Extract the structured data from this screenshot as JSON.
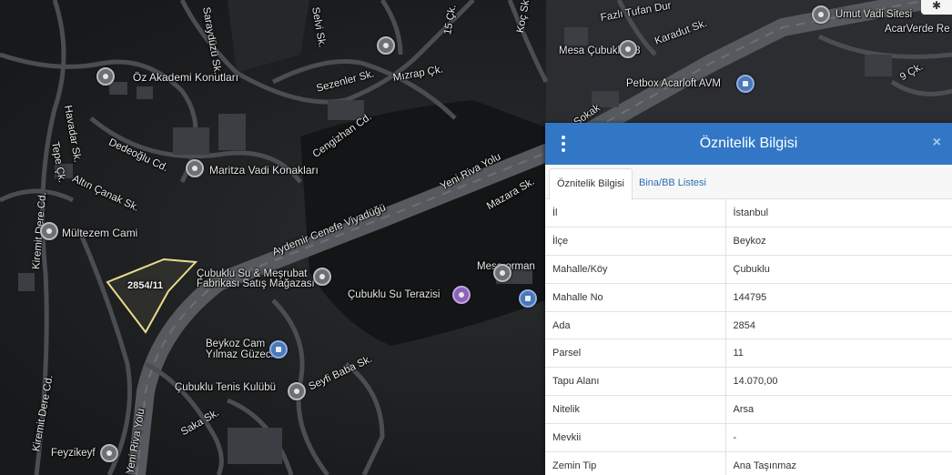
{
  "map": {
    "labels": [
      "Öz Akademi Konutları",
      "Maritza Vadi Konakları",
      "Mültezem Cami",
      "Çubuklu Su & Meşrubat",
      "Fabrikası Satış Mağazası",
      "Çubuklu Su Terazisi",
      "Beykoz Cam",
      "Yılmaz Güzeci",
      "Çubuklu Tenis Kulübü",
      "Feyzikeyf",
      "Mesa orman",
      "Mesa Çubuklu 28",
      "Petbox Acarloft AVM",
      "Umut Vadi Sitesi",
      "AcarVerde Re",
      "Yeni Riva Yolu",
      "Aydemir Cenefe Viyadüğü",
      "Dedeoğlu Cd.",
      "Altın Çanak Sk.",
      "Havadar Sk.",
      "Tepe Çk.",
      "Kiremit Dere Cd.",
      "Sezenler Sk.",
      "Mızrap Çk.",
      "Cengizhan Cd.",
      "Karadut Sk.",
      "Seyfi Baba Sk.",
      "Saka Sk.",
      "Yeni Riva Yolu",
      "Sokak",
      "Mazara Sk.",
      "Kiremit Dere Cd.",
      "Fazlı Tufan Dur",
      "Selvi Sk.",
      "Koç Sk.",
      "15 Çk.",
      "9 Çk.",
      "Saraydüzü Sk."
    ],
    "parcel_label": "2854/11"
  },
  "panel": {
    "title": "Öznitelik Bilgisi",
    "close": "×",
    "tabs": [
      "Öznitelik Bilgisi",
      "Bina/BB Listesi"
    ],
    "rows": [
      {
        "k": "İl",
        "v": "İstanbul"
      },
      {
        "k": "İlçe",
        "v": "Beykoz"
      },
      {
        "k": "Mahalle/Köy",
        "v": "Çubuklu"
      },
      {
        "k": "Mahalle No",
        "v": "144795"
      },
      {
        "k": "Ada",
        "v": "2854"
      },
      {
        "k": "Parsel",
        "v": "11"
      },
      {
        "k": "Tapu Alanı",
        "v": "14.070,00"
      },
      {
        "k": "Nitelik",
        "v": "Arsa"
      },
      {
        "k": "Mevkii",
        "v": "-"
      },
      {
        "k": "Zemin Tip",
        "v": "Ana Taşınmaz"
      }
    ]
  },
  "icons": {
    "menu": "kebab-menu-icon",
    "close": "close-icon",
    "settings": "gear-icon",
    "poi": "map-poi-icon"
  }
}
